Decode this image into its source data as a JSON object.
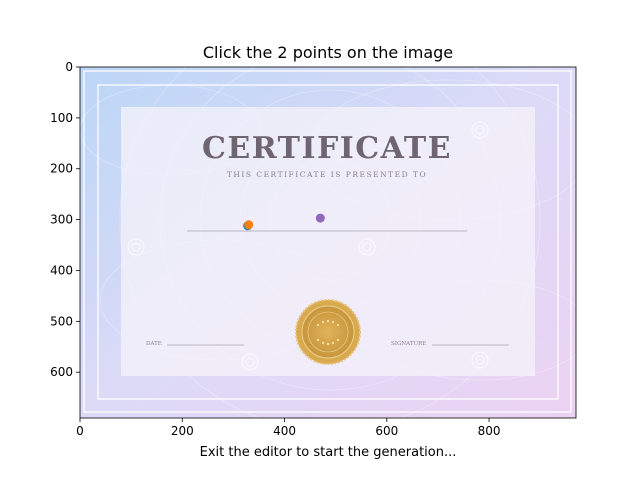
{
  "window": {
    "title": "Click the 2 points on the image",
    "status": "Exit the editor to start the generation..."
  },
  "certificate": {
    "heading": "CERTIFICATE",
    "subheading": "THIS CERTIFICATE IS PRESENTED TO",
    "date_label": "DATE",
    "signature_label": "SIGNATURE",
    "seal_color": "#d4a24a"
  },
  "chart_data": {
    "type": "scatter",
    "title": "Click the 2 points on the image",
    "xlabel": "Exit the editor to start the generation...",
    "ylabel": "",
    "xlim": [
      0,
      970
    ],
    "ylim": [
      690,
      0
    ],
    "xticks": [
      0,
      200,
      400,
      600,
      800
    ],
    "yticks": [
      0,
      100,
      200,
      300,
      400,
      500,
      600
    ],
    "grid": false,
    "points": [
      {
        "x": 328,
        "y": 312,
        "color": "#1f77b4"
      },
      {
        "x": 330,
        "y": 310,
        "color": "#ff7f0e"
      },
      {
        "x": 470,
        "y": 297,
        "color": "#9467bd"
      }
    ]
  }
}
